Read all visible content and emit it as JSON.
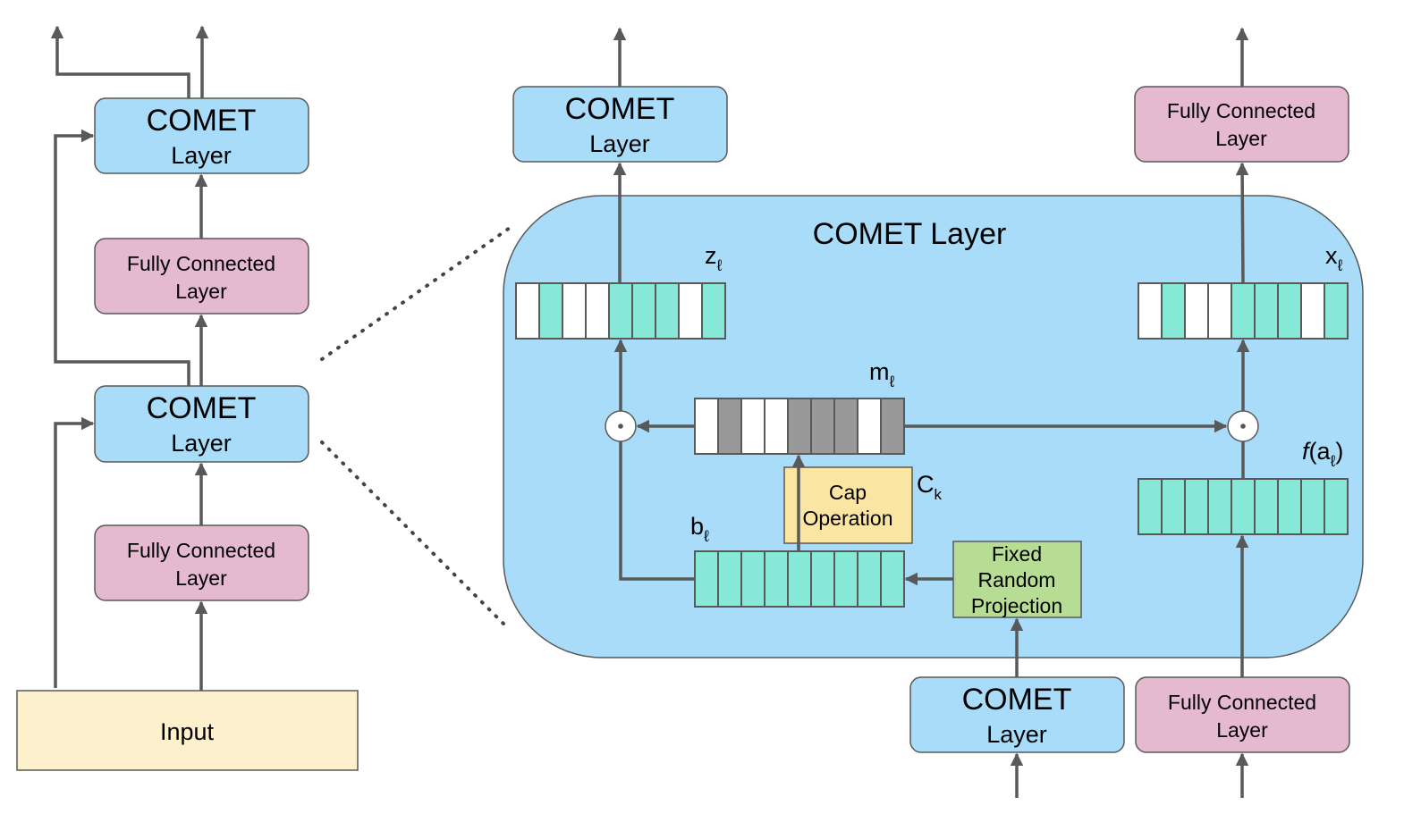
{
  "colors": {
    "comet": "#a9dcf9",
    "fully_connected": "#e5b9d0",
    "input": "#fcf0cd",
    "cap": "#fae5a2",
    "projection": "#b7dd95",
    "active": "#86e8d6",
    "masked": "#999999",
    "empty": "#ffffff",
    "line": "#595959"
  },
  "left_stack": {
    "comet_top": {
      "line1": "COMET",
      "line2": "Layer"
    },
    "fc_upper": {
      "line1": "Fully Connected",
      "line2": "Layer"
    },
    "comet_lower": {
      "line1": "COMET",
      "line2": "Layer"
    },
    "fc_lower": {
      "line1": "Fully Connected",
      "line2": "Layer"
    },
    "input": "Input"
  },
  "detail": {
    "title": "COMET Layer",
    "top_comet": {
      "line1": "COMET",
      "line2": "Layer"
    },
    "top_fc": {
      "line1": "Fully Connected",
      "line2": "Layer"
    },
    "bottom_comet": {
      "line1": "COMET",
      "line2": "Layer"
    },
    "bottom_fc": {
      "line1": "Fully Connected",
      "line2": "Layer"
    },
    "cap": {
      "line1": "Cap",
      "line2": "Operation",
      "label": "C",
      "label_sub": "k"
    },
    "projection": {
      "line1": "Fixed",
      "line2": "Random",
      "line3": "Projection"
    },
    "vectors": {
      "z": {
        "name": "z",
        "sub": "ℓ",
        "cells": [
          "empty",
          "active",
          "empty",
          "empty",
          "active",
          "active",
          "active",
          "empty",
          "active"
        ]
      },
      "x": {
        "name": "x",
        "sub": "ℓ",
        "cells": [
          "empty",
          "active",
          "empty",
          "empty",
          "active",
          "active",
          "active",
          "empty",
          "active"
        ]
      },
      "m": {
        "name": "m",
        "sub": "ℓ",
        "cells": [
          "empty",
          "masked",
          "empty",
          "empty",
          "masked",
          "masked",
          "masked",
          "empty",
          "masked"
        ]
      },
      "b": {
        "name": "b",
        "sub": "ℓ",
        "cells": [
          "active",
          "active",
          "active",
          "active",
          "active",
          "active",
          "active",
          "active",
          "active"
        ]
      },
      "f": {
        "prefix": "f",
        "name": "(a",
        "sub": "ℓ",
        "suffix": ")",
        "cells": [
          "active",
          "active",
          "active",
          "active",
          "active",
          "active",
          "active",
          "active",
          "active"
        ]
      }
    },
    "operator": "⊙"
  }
}
